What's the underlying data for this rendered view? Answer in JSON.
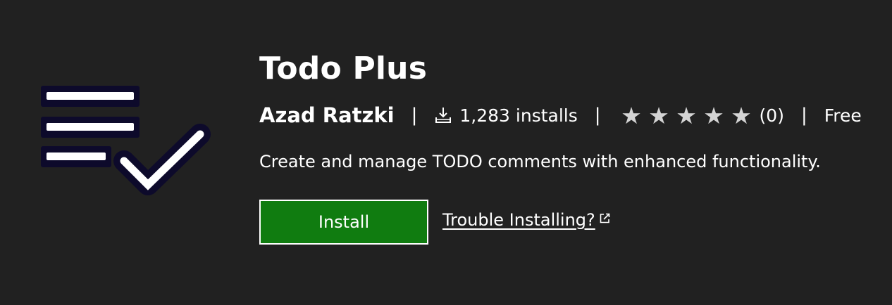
{
  "extension": {
    "icon": "todo-checklist-icon",
    "title": "Todo Plus",
    "publisher": "Azad Ratzki",
    "separator": "|",
    "installs": "1,283 installs",
    "rating": {
      "stars_total": 5,
      "stars_filled": 0,
      "star_glyph": "★",
      "count_label": "(0)"
    },
    "price": "Free",
    "description": "Create and manage TODO comments with enhanced functionality."
  },
  "actions": {
    "install_label": "Install",
    "trouble_label": "Trouble Installing?"
  },
  "colors": {
    "background": "#212121",
    "install_button": "#107c10",
    "text": "#ffffff",
    "star": "#d4d4d4",
    "icon_outline": "#0d0a2b"
  }
}
